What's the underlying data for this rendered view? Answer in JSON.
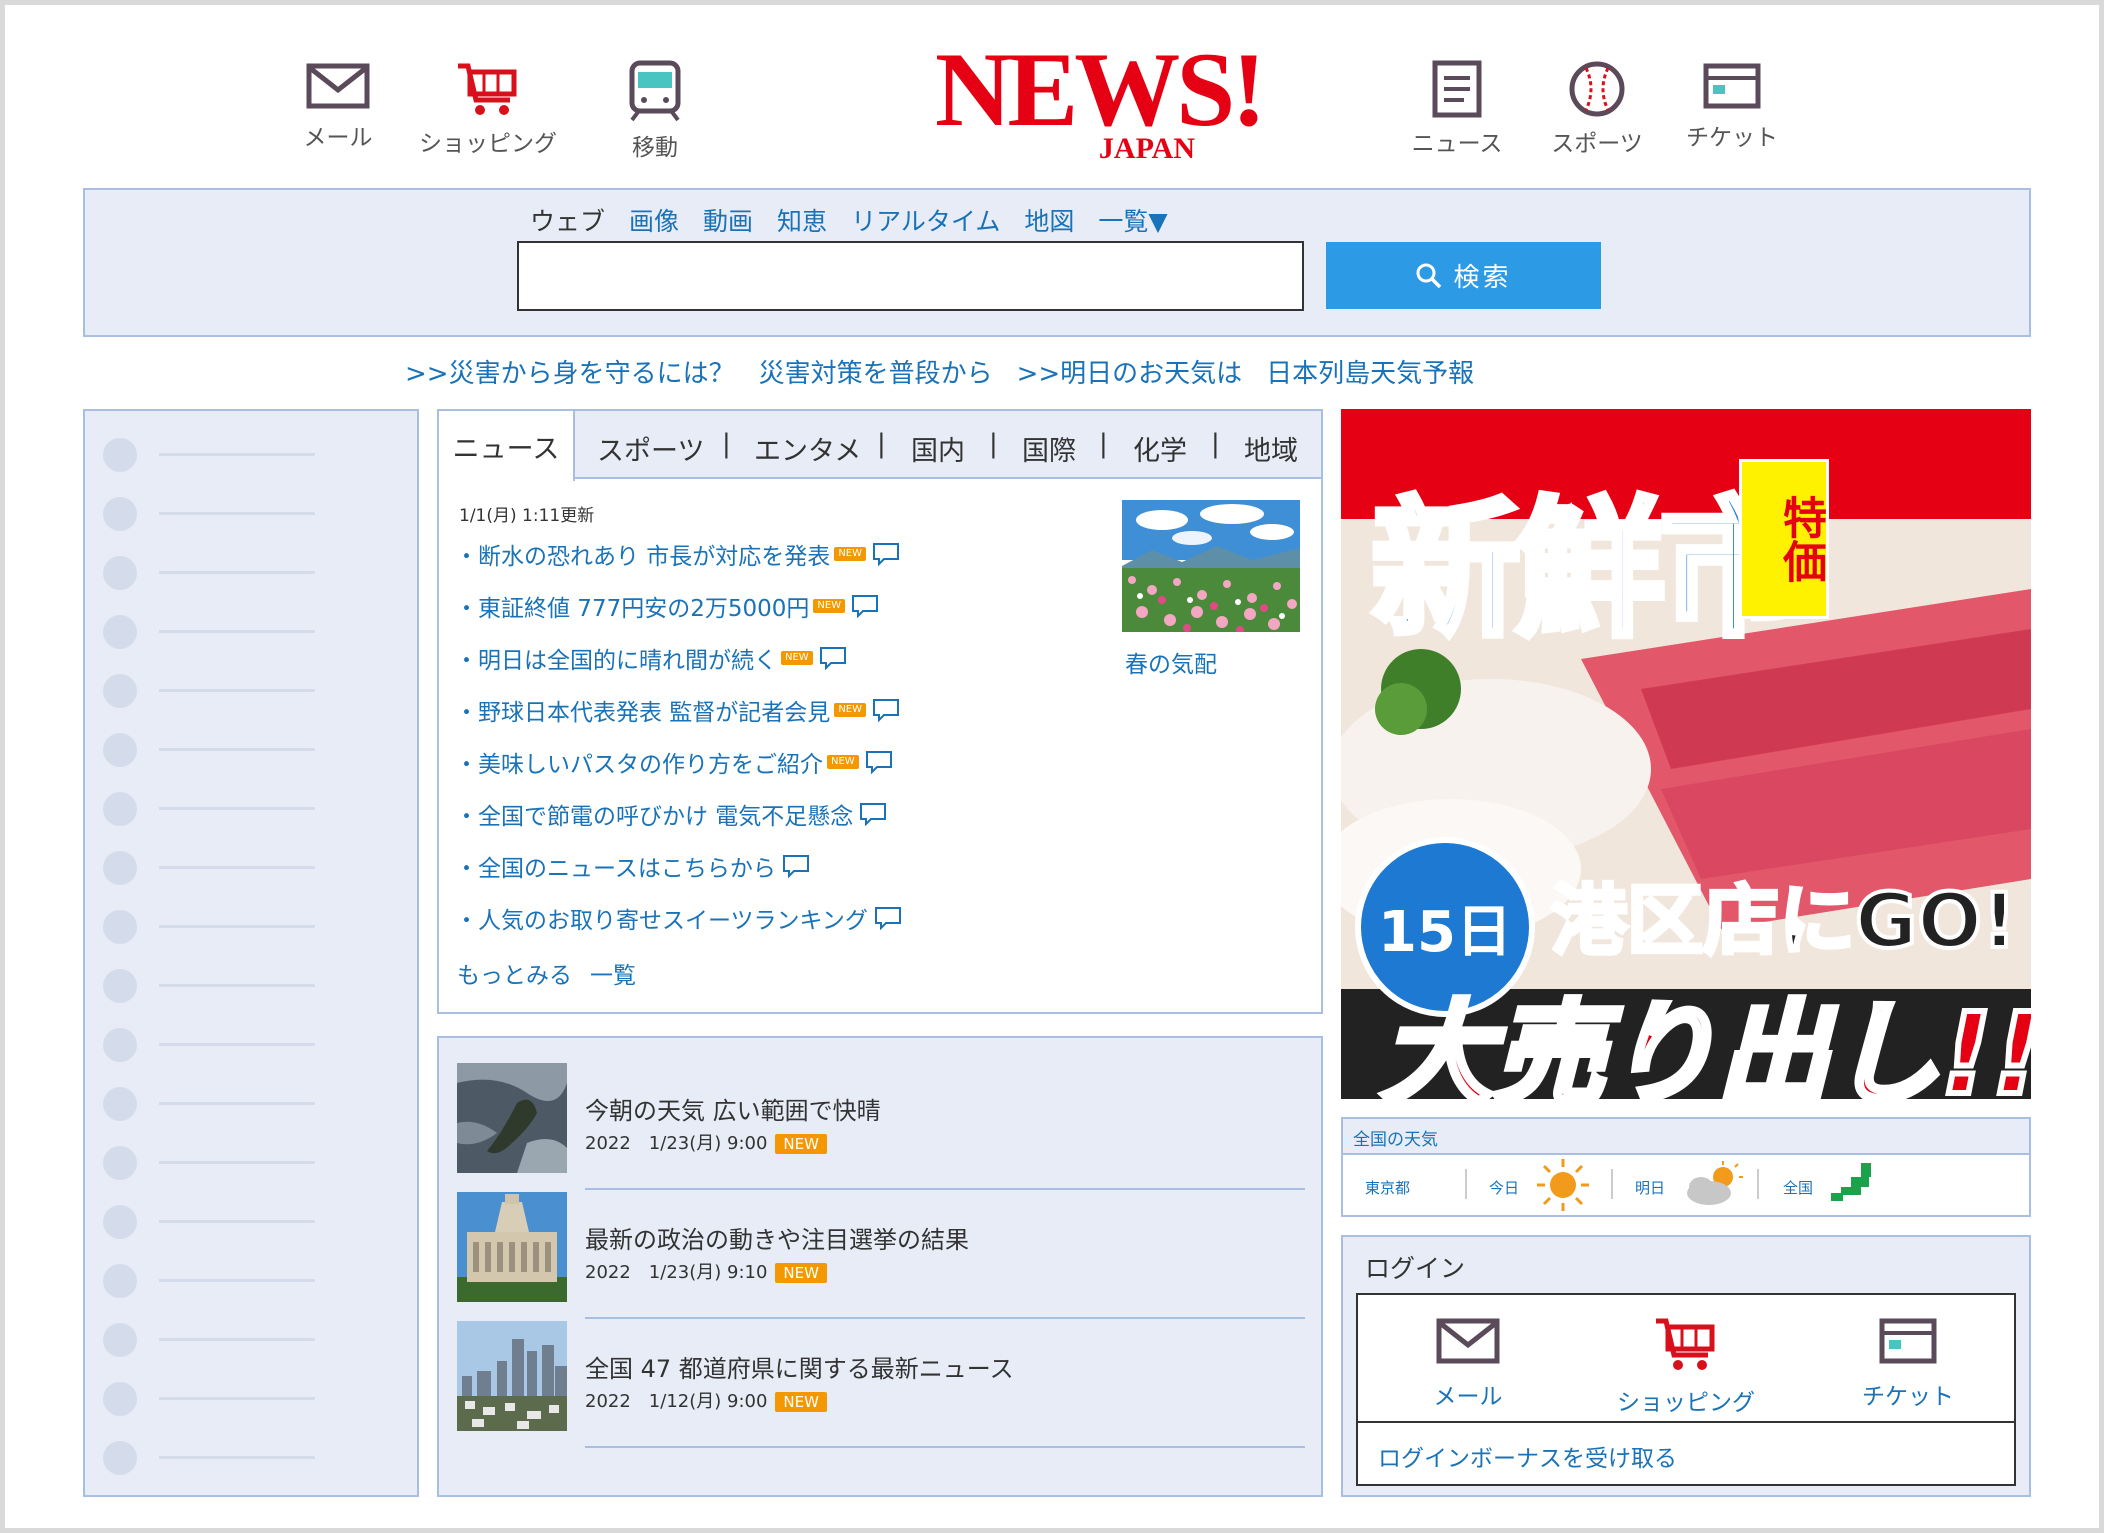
{
  "header": {
    "nav_left": [
      {
        "label": "メール",
        "icon": "mail-icon"
      },
      {
        "label": "ショッピング",
        "icon": "cart-icon"
      },
      {
        "label": "移動",
        "icon": "train-icon"
      }
    ],
    "nav_right": [
      {
        "label": "ニュース",
        "icon": "news-icon"
      },
      {
        "label": "スポーツ",
        "icon": "baseball-icon"
      },
      {
        "label": "チケット",
        "icon": "ticket-icon"
      }
    ],
    "logo_main": "NEWS!",
    "logo_sub": "JAPAN"
  },
  "search": {
    "tabs": [
      "ウェブ",
      "画像",
      "動画",
      "知恵",
      "リアルタイム",
      "地図",
      "一覧▼"
    ],
    "placeholder": "",
    "button_label": "検索"
  },
  "ticker": [
    ">>災害から身を守るには？",
    "災害対策を普段から",
    ">>明日のお天気は",
    "日本列島天気予報"
  ],
  "news": {
    "tabs": [
      "ニュース",
      "スポーツ",
      "エンタメ",
      "国内",
      "国際",
      "化学",
      "地域"
    ],
    "updated": "1/1(月) 1:11更新",
    "items": [
      {
        "title": "断水の恐れあり 市長が対応を発表",
        "new": "NEW"
      },
      {
        "title": "東証終値 777円安の2万5000円",
        "new": "NEW"
      },
      {
        "title": "明日は全国的に晴れ間が続く",
        "new": "NEW"
      },
      {
        "title": "野球日本代表発表 監督が記者会見",
        "new": "NEW"
      },
      {
        "title": "美味しいパスタの作り方をご紹介",
        "new": "NEW"
      },
      {
        "title": "全国で節電の呼びかけ 電気不足懸念",
        "new": ""
      },
      {
        "title": "全国のニュースはこちらから",
        "new": ""
      },
      {
        "title": "人気のお取り寄せスイーツランキング",
        "new": ""
      }
    ],
    "more": "もっとみる",
    "list_all": "一覧",
    "feature_caption": "春の気配",
    "bullet": "・"
  },
  "articles": [
    {
      "title": "今朝の天気 広い範囲で快晴",
      "date": "2022　1/23(月) 9:00",
      "badge": "NEW"
    },
    {
      "title": "最新の政治の動きや注目選挙の結果",
      "date": "2022　1/23(月) 9:10",
      "badge": "NEW"
    },
    {
      "title": "全国 47 都道府県に関する最新ニュース",
      "date": "2022　1/12(月) 9:00",
      "badge": "NEW"
    }
  ],
  "ad": {
    "headline": "新鮮市",
    "special": "特価",
    "day": "15日",
    "store": "港区店にGO!",
    "sale": "大売り出し!!"
  },
  "weather": {
    "title": "全国の天気",
    "city": "東京都",
    "today": "今日",
    "tomorrow": "明日",
    "nationwide": "全国",
    "today_icon": "sun-icon",
    "tomorrow_icon": "cloud-sun-icon"
  },
  "login": {
    "title": "ログイン",
    "services": [
      {
        "label": "メール",
        "icon": "mail-icon"
      },
      {
        "label": "ショッピング",
        "icon": "cart-icon"
      },
      {
        "label": "チケット",
        "icon": "ticket-icon"
      }
    ],
    "bonus": "ログインボーナスを受け取る"
  },
  "colors": {
    "accent": "#e50013",
    "link": "#1a73b8",
    "panel_bg": "#e7ecf6",
    "panel_border": "#a9bfe1",
    "search_button": "#2c9ae4",
    "new_badge": "#f39800"
  }
}
